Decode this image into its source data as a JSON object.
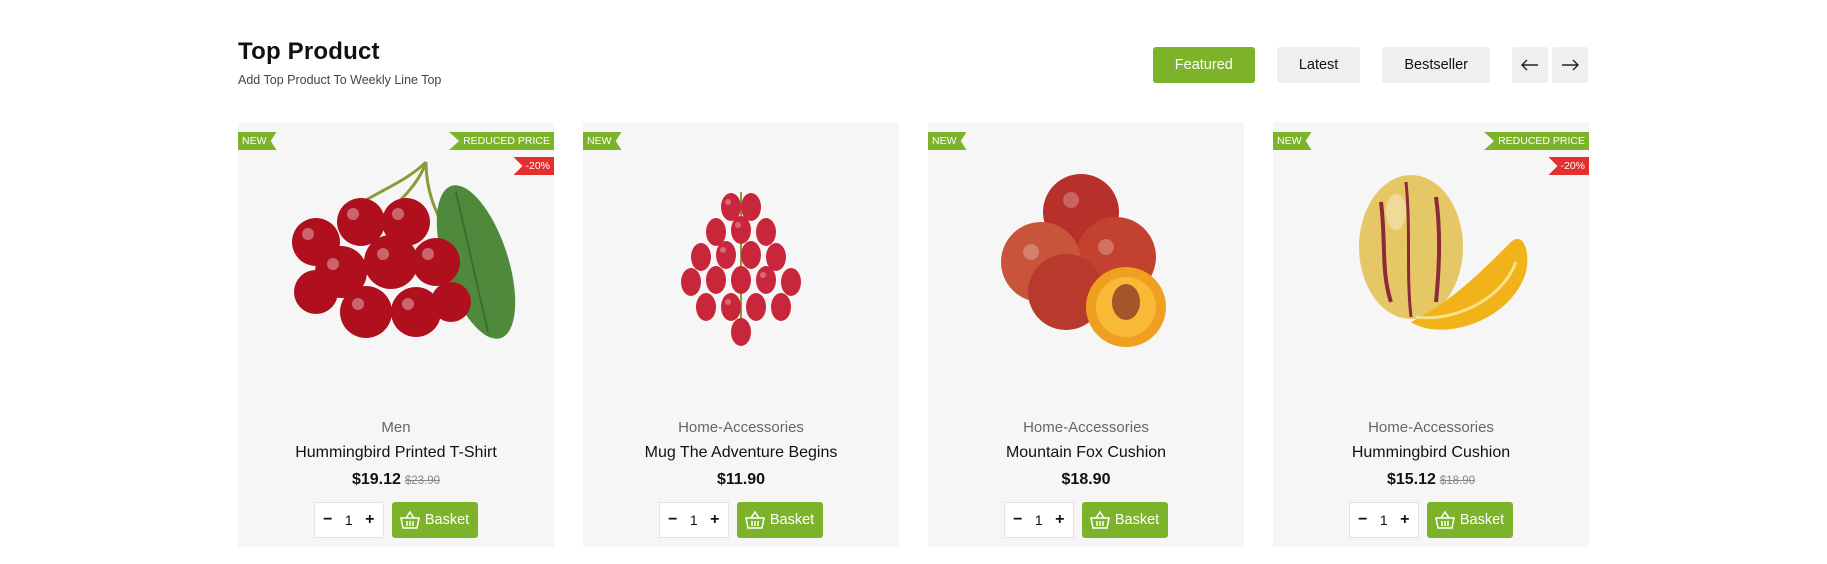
{
  "section": {
    "title": "Top Product",
    "subtitle": "Add Top Product To Weekly Line Top"
  },
  "tabs": [
    {
      "label": "Featured",
      "active": true
    },
    {
      "label": "Latest",
      "active": false
    },
    {
      "label": "Bestseller",
      "active": false
    }
  ],
  "nav": {
    "prev_icon": "arrow-left-icon",
    "next_icon": "arrow-right-icon"
  },
  "colors": {
    "accent": "#7cb32a",
    "discount": "#e52e2e",
    "card_bg": "#f6f6f6"
  },
  "products": [
    {
      "image": "cherries",
      "badge_new": "NEW",
      "badge_reduced": "REDUCED PRICE",
      "discount": "-20%",
      "category": "Men",
      "name": "Hummingbird Printed T-Shirt",
      "price": "$19.12",
      "old_price": "$23.90",
      "qty": "1",
      "basket_label": "Basket"
    },
    {
      "image": "grapes",
      "badge_new": "NEW",
      "category": "Home-Accessories",
      "name": "Mug The Adventure Begins",
      "price": "$11.90",
      "qty": "1",
      "basket_label": "Basket"
    },
    {
      "image": "peaches",
      "badge_new": "NEW",
      "category": "Home-Accessories",
      "name": "Mountain Fox Cushion",
      "price": "$18.90",
      "qty": "1",
      "basket_label": "Basket"
    },
    {
      "image": "pepino-melon",
      "badge_new": "NEW",
      "badge_reduced": "REDUCED PRICE",
      "discount": "-20%",
      "category": "Home-Accessories",
      "name": "Hummingbird Cushion",
      "price": "$15.12",
      "old_price": "$18.90",
      "qty": "1",
      "basket_label": "Basket"
    }
  ]
}
